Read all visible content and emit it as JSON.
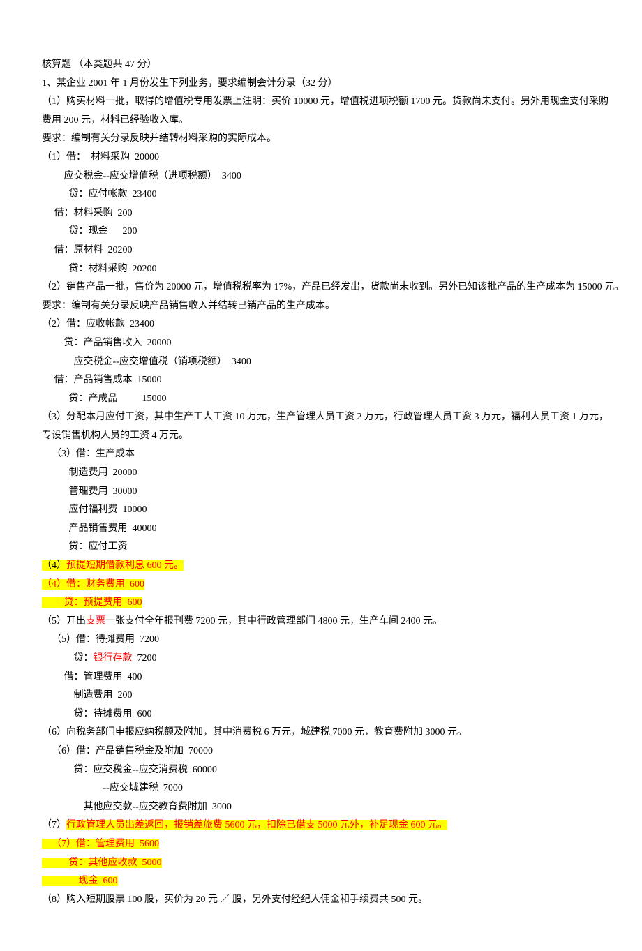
{
  "lines": [
    {
      "segs": [
        {
          "t": "核算题 （本类题共 47 分）"
        }
      ]
    },
    {
      "segs": [
        {
          "t": "1、某企业 2001 年 1 月份发生下列业务，要求编制会计分录（32 分）"
        }
      ]
    },
    {
      "segs": [
        {
          "t": "（1）购买材料一批，取得的增值税专用发票上注明：买价 10000 元，增值税进项税额 1700 元。货款尚未支付。另外用现金支付采购"
        }
      ]
    },
    {
      "segs": [
        {
          "t": "费用 200 元，材料已经验收入库。"
        }
      ]
    },
    {
      "segs": [
        {
          "t": "要求：编制有关分录反映并结转材料采购的实际成本。"
        }
      ]
    },
    {
      "segs": [
        {
          "t": "（1）借：  材料采购  20000"
        }
      ]
    },
    {
      "segs": [
        {
          "t": "         应交税金--应交增值税（进项税额）  3400"
        }
      ]
    },
    {
      "segs": [
        {
          "t": "           贷：应付帐款  23400"
        }
      ]
    },
    {
      "segs": [
        {
          "t": "     借：材料采购  200"
        }
      ]
    },
    {
      "segs": [
        {
          "t": "           贷：现金      200"
        }
      ]
    },
    {
      "segs": [
        {
          "t": "     借：原材料  20200"
        }
      ]
    },
    {
      "segs": [
        {
          "t": "           贷：材料采购  20200"
        }
      ]
    },
    {
      "segs": [
        {
          "t": "（2）销售产品一批，售价为 20000 元，增值税税率为 17%，产品已经发出，货款尚未收到。另外已知该批产品的生产成本为 15000 元。"
        }
      ]
    },
    {
      "segs": [
        {
          "t": "要求：编制有关分录反映产品销售收入并结转已销产品的生产成本。"
        }
      ]
    },
    {
      "segs": [
        {
          "t": "（2）借：应收帐款  23400"
        }
      ]
    },
    {
      "segs": [
        {
          "t": "         贷：产品销售收入  20000"
        }
      ]
    },
    {
      "segs": [
        {
          "t": "             应交税金--应交增值税（销项税额）  3400"
        }
      ]
    },
    {
      "segs": [
        {
          "t": "     借：产品销售成本  15000"
        }
      ]
    },
    {
      "segs": [
        {
          "t": "           贷：产成品          15000"
        }
      ]
    },
    {
      "segs": [
        {
          "t": "（3）分配本月应付工资，其中生产工人工资 10 万元，生产管理人员工资 2 万元，行政管理人员工资 3 万元，福利人员工资 1 万元，"
        }
      ]
    },
    {
      "segs": [
        {
          "t": "专设销售机构人员的工资 4 万元。"
        }
      ]
    },
    {
      "segs": [
        {
          "t": "    （3）借：生产成本"
        }
      ]
    },
    {
      "segs": [
        {
          "t": "           制造费用  20000"
        }
      ]
    },
    {
      "segs": [
        {
          "t": "           管理费用  30000"
        }
      ]
    },
    {
      "segs": [
        {
          "t": "           应付福利费  10000"
        }
      ]
    },
    {
      "segs": [
        {
          "t": "           产品销售费用  40000"
        }
      ]
    },
    {
      "segs": [
        {
          "t": "           贷：应付工资"
        }
      ]
    },
    {
      "segs": [
        {
          "t": "（4）",
          "hl": true
        },
        {
          "t": "预提短期借款利息 600 元。",
          "hl": true,
          "red": true
        }
      ]
    },
    {
      "segs": [
        {
          "t": "（4）借：财务费用  600",
          "hl": true,
          "red": true
        }
      ]
    },
    {
      "segs": [
        {
          "t": "         贷：预提费用  600",
          "hl": true,
          "red": true
        }
      ]
    },
    {
      "segs": [
        {
          "t": "（5）开出"
        },
        {
          "t": "支票",
          "red": true
        },
        {
          "t": "一张支付全年报刊费 7200 元，其中行政管理部门 4800 元，生产车间 2400 元。"
        }
      ]
    },
    {
      "segs": [
        {
          "t": "    （5）借：待摊费用  7200"
        }
      ]
    },
    {
      "segs": [
        {
          "t": "             贷："
        },
        {
          "t": "银行存款",
          "red": true
        },
        {
          "t": "  7200"
        }
      ]
    },
    {
      "segs": [
        {
          "t": "         借：管理费用  400"
        }
      ]
    },
    {
      "segs": [
        {
          "t": "             制造费用  200"
        }
      ]
    },
    {
      "segs": [
        {
          "t": "             贷：待摊费用  600"
        }
      ]
    },
    {
      "segs": [
        {
          "t": "（6）向税务部门申报应纳税额及附加，其中消费税 6 万元，城建税 7000 元，教育费附加 3000 元。"
        }
      ]
    },
    {
      "segs": [
        {
          "t": "    （6）借：产品销售税金及附加  70000"
        }
      ]
    },
    {
      "segs": [
        {
          "t": "             贷：应交税金--应交消费税  60000"
        }
      ]
    },
    {
      "segs": [
        {
          "t": "                         --应交城建税  7000"
        }
      ]
    },
    {
      "segs": [
        {
          "t": "                 其他应交款--应交教育费附加  3000"
        }
      ]
    },
    {
      "segs": [
        {
          "t": "（7）"
        },
        {
          "t": "行政管理人员出差返回，报销差旅费 5600 元，扣除已借支 5000 元外，补足现金 600 元。",
          "hl": true,
          "red": true
        }
      ]
    },
    {
      "segs": [
        {
          "t": "    （7）借：管理费用  5600",
          "hl": true,
          "red": true
        }
      ]
    },
    {
      "segs": [
        {
          "t": "           贷：其他应收款  5000",
          "hl": true,
          "red": true
        }
      ]
    },
    {
      "segs": [
        {
          "t": "               现金  600",
          "hl": true,
          "red": true
        }
      ]
    },
    {
      "segs": [
        {
          "t": "（8）购入短期股票 100 股，买价为 20 元 ／ 股，另外支付经纪人佣金和手续费共 500 元。"
        }
      ]
    }
  ]
}
